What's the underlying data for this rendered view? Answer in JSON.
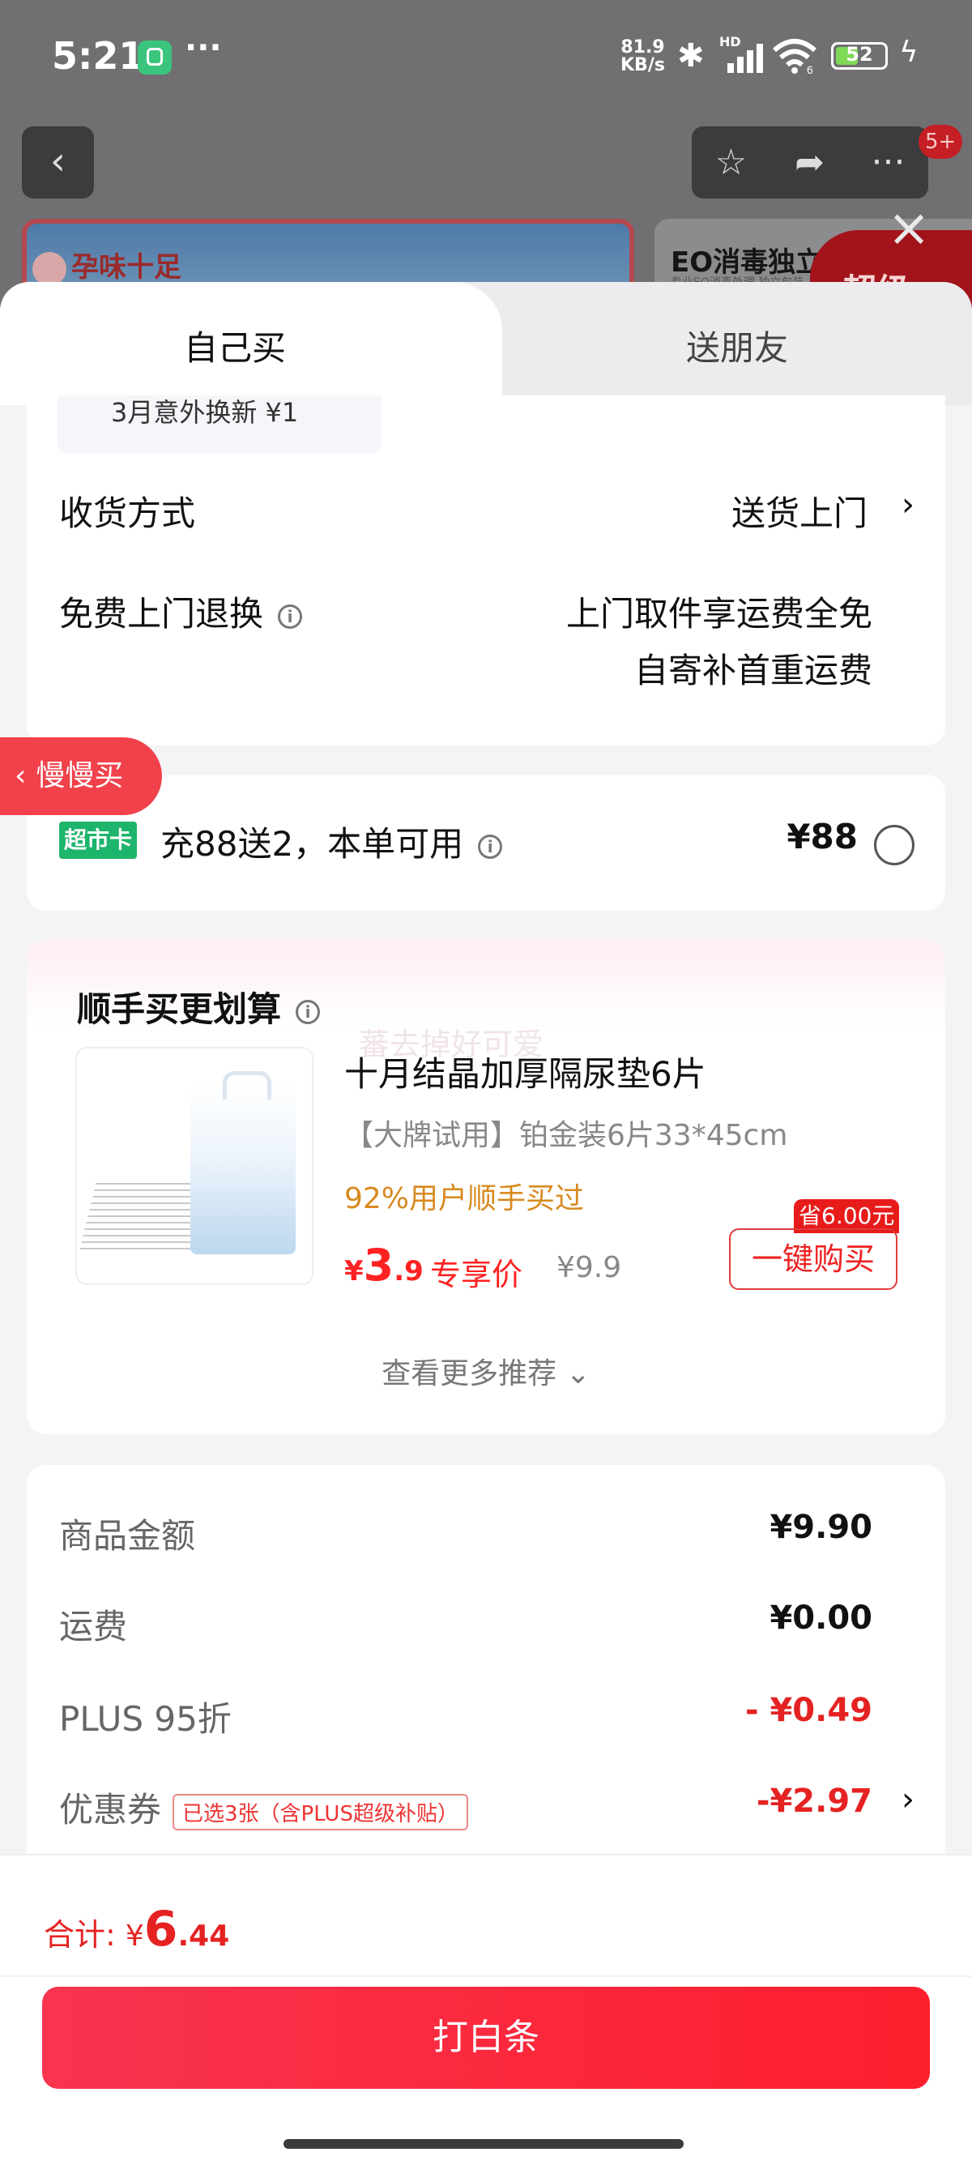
{
  "status_bar": {
    "time": "5:21",
    "dots": "···",
    "net_speed_value": "81.9",
    "net_speed_unit": "KB/s",
    "hd": "HD",
    "wifi_sub": "6",
    "battery": "52"
  },
  "background_page": {
    "badge": "5+",
    "banner_left_logo": "孕味十足",
    "banner_right_title": "EO消毒独立装",
    "banner_right_sub": "专业EO消毒处理 独立包装",
    "banner_red_text": "超级"
  },
  "tabs": {
    "active": "自己买",
    "other": "送朋友"
  },
  "delivery": {
    "partial_chip": "3月意外换新 ¥1",
    "method_label": "收货方式",
    "method_value": "送货上门",
    "returns_label": "免费上门退换",
    "returns_value_1": "上门取件享运费全免",
    "returns_value_2": "自寄补首重运费"
  },
  "side_tab": "慢慢买",
  "supermarket": {
    "badge": "超市卡",
    "text": "充88送2，本单可用",
    "price": "¥88"
  },
  "addon": {
    "title": "顺手买更划算",
    "ghost_text": "蕃去掉好可爱",
    "product_name": "十月结晶加厚隔尿垫6片",
    "product_spec": "【大牌试用】铂金装6片33*45cm",
    "bought": "92%用户顺手买过",
    "price_symbol": "¥",
    "price_int": "3",
    "price_dec": ".9",
    "price_tag": "专享价",
    "orig_price": "¥9.9",
    "save": "省6.00元",
    "buy_label": "一键购买",
    "more": "查看更多推荐"
  },
  "summary": {
    "rows": [
      {
        "label": "商品金额",
        "value": "¥9.90"
      },
      {
        "label": "运费",
        "value": "¥0.00"
      },
      {
        "label": "PLUS 95折",
        "value": "- ¥0.49"
      },
      {
        "label": "优惠券",
        "tag": "已选3张（含PLUS超级补贴）",
        "value": "-¥2.97"
      }
    ]
  },
  "footer": {
    "total_label": "合计:",
    "total_symbol": "¥",
    "total_int": "6",
    "total_dec": ".44",
    "pay_label": "打白条"
  },
  "colors": {
    "accent_red": "#f22d3f",
    "badge_green": "#1db46b",
    "price_red": "#e52222"
  }
}
